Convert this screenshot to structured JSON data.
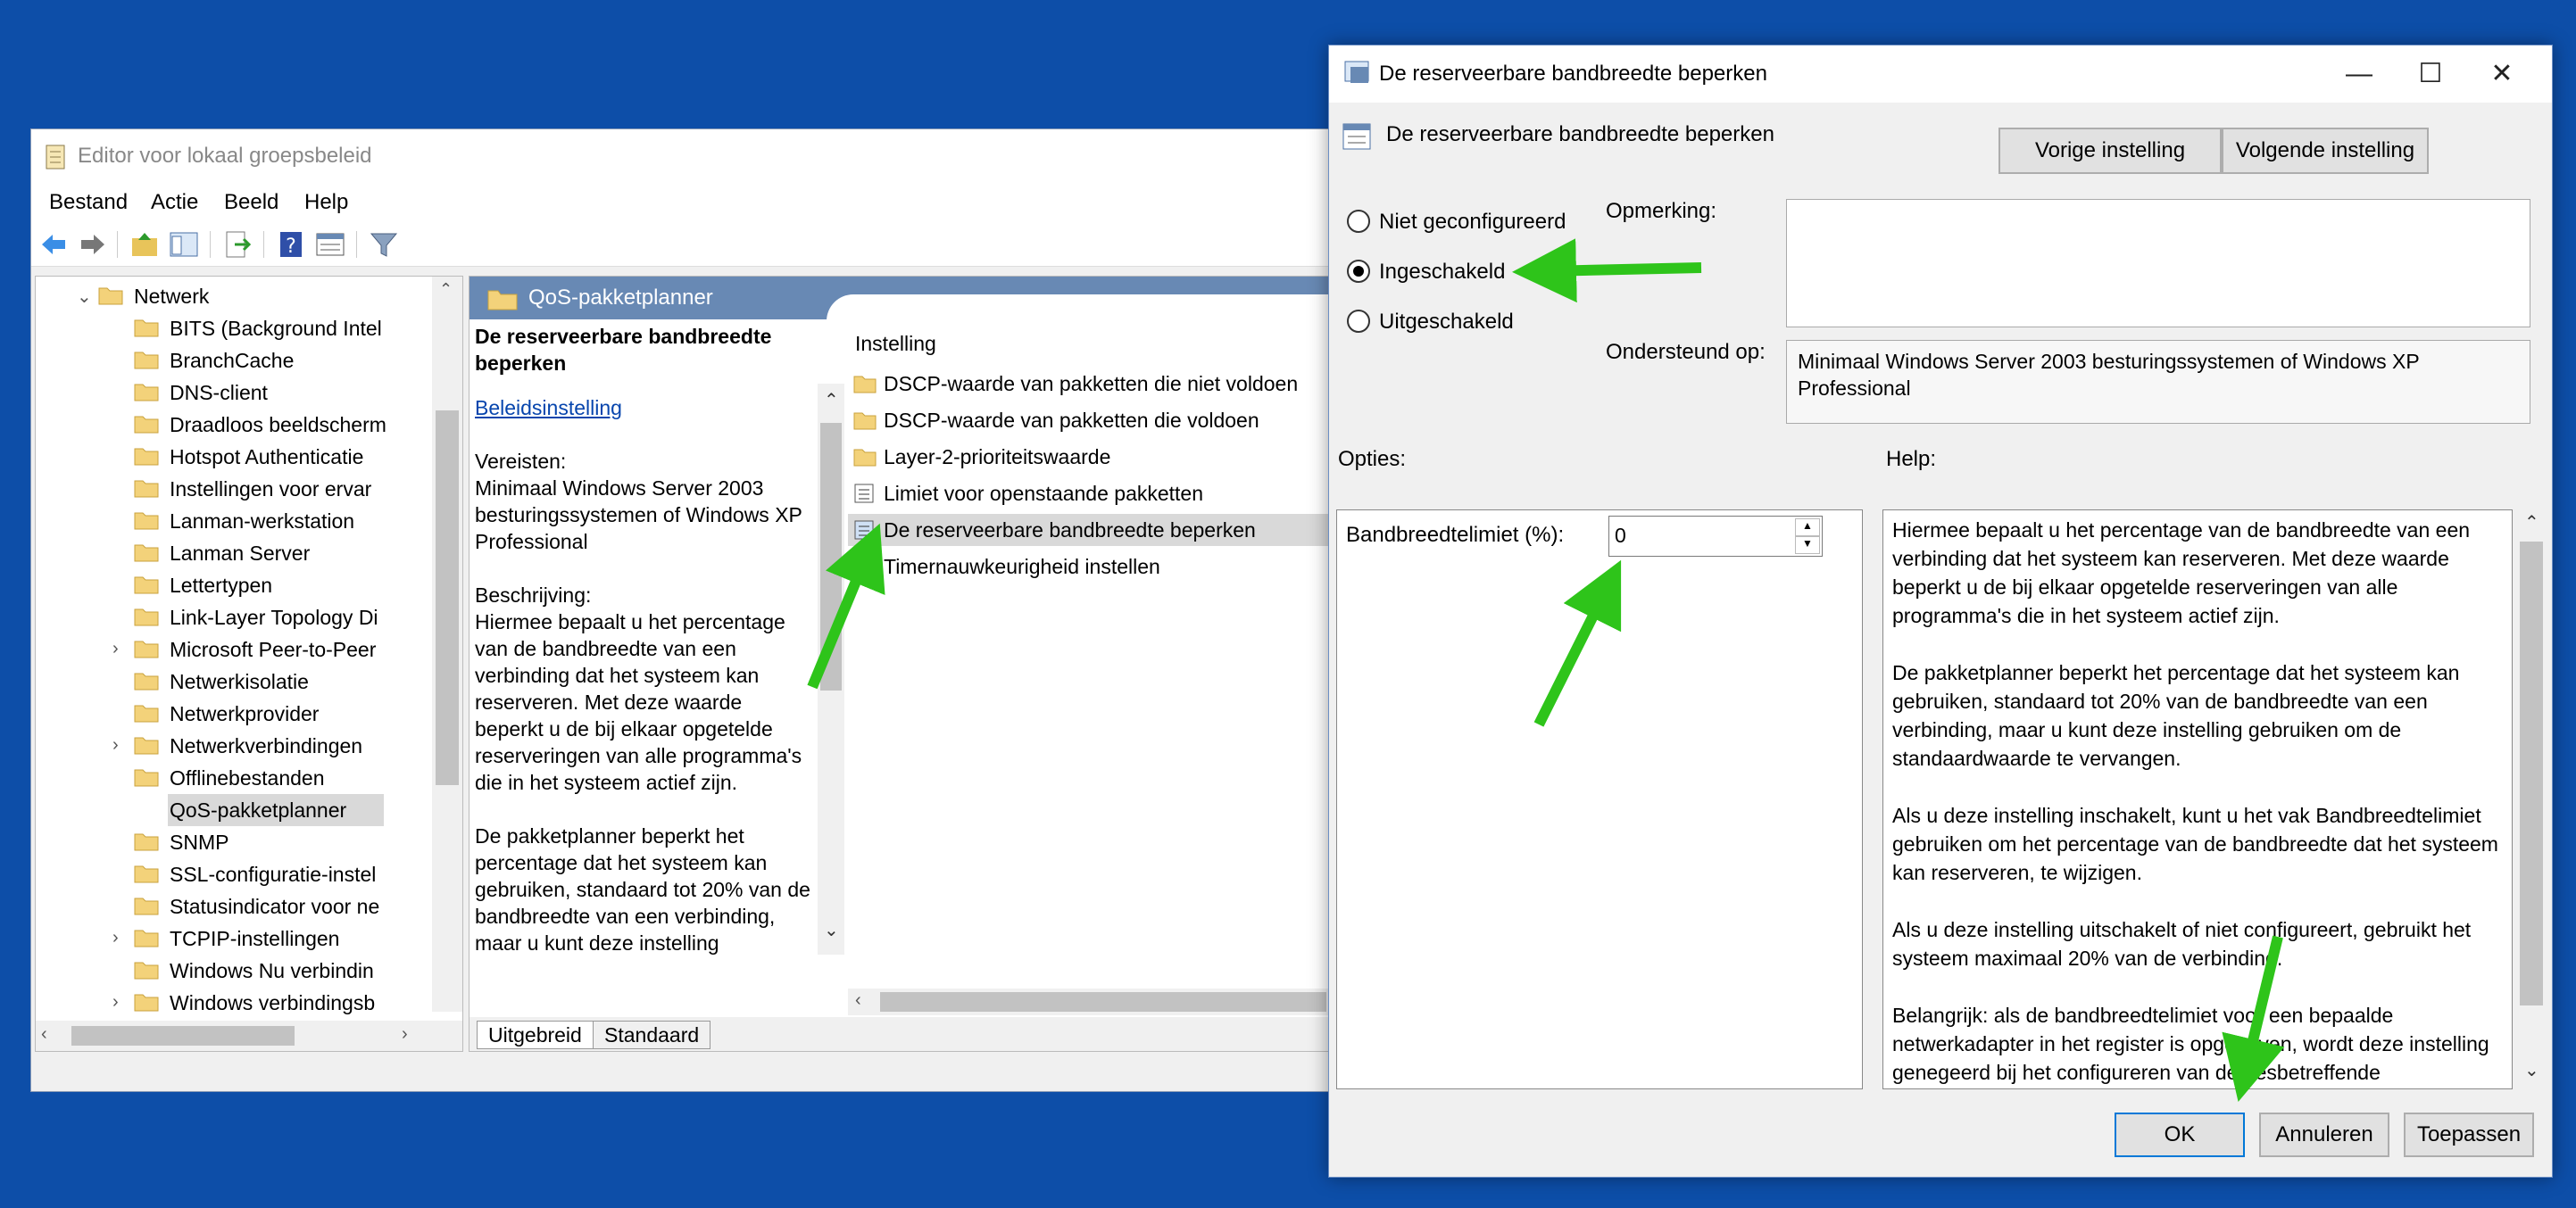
{
  "editor": {
    "title": "Editor voor lokaal groepsbeleid",
    "menu": [
      "Bestand",
      "Actie",
      "Beeld",
      "Help"
    ],
    "tree": [
      {
        "label": "Netwerk",
        "depth": 0,
        "expander": "v"
      },
      {
        "label": "BITS (Background Intel",
        "depth": 1,
        "expander": ""
      },
      {
        "label": "BranchCache",
        "depth": 1,
        "expander": ""
      },
      {
        "label": "DNS-client",
        "depth": 1,
        "expander": ""
      },
      {
        "label": "Draadloos beeldscherm",
        "depth": 1,
        "expander": ""
      },
      {
        "label": "Hotspot Authenticatie",
        "depth": 1,
        "expander": ""
      },
      {
        "label": "Instellingen voor ervar",
        "depth": 1,
        "expander": ""
      },
      {
        "label": "Lanman-werkstation",
        "depth": 1,
        "expander": ""
      },
      {
        "label": "Lanman Server",
        "depth": 1,
        "expander": ""
      },
      {
        "label": "Lettertypen",
        "depth": 1,
        "expander": ""
      },
      {
        "label": "Link-Layer Topology Di",
        "depth": 1,
        "expander": ""
      },
      {
        "label": "Microsoft Peer-to-Peer",
        "depth": 1,
        "expander": ">"
      },
      {
        "label": "Netwerkisolatie",
        "depth": 1,
        "expander": ""
      },
      {
        "label": "Netwerkprovider",
        "depth": 1,
        "expander": ""
      },
      {
        "label": "Netwerkverbindingen",
        "depth": 1,
        "expander": ">"
      },
      {
        "label": "Offlinebestanden",
        "depth": 1,
        "expander": ""
      },
      {
        "label": "QoS-pakketplanner",
        "depth": 1,
        "expander": ">",
        "selected": true
      },
      {
        "label": "SNMP",
        "depth": 1,
        "expander": ""
      },
      {
        "label": "SSL-configuratie-instel",
        "depth": 1,
        "expander": ""
      },
      {
        "label": "Statusindicator voor ne",
        "depth": 1,
        "expander": ""
      },
      {
        "label": "TCPIP-instellingen",
        "depth": 1,
        "expander": ">"
      },
      {
        "label": "Windows Nu verbindin",
        "depth": 1,
        "expander": ""
      },
      {
        "label": "Windows verbindingsb",
        "depth": 1,
        "expander": ">"
      }
    ],
    "pane_header": "QoS-pakketplanner",
    "desc": {
      "title": "De reserveerbare bandbreedte beperken",
      "link": "Beleidsinstelling",
      "requirements_label": "Vereisten:",
      "requirements": "Minimaal Windows Server 2003 besturingssystemen of Windows XP Professional",
      "description_label": "Beschrijving:",
      "description": "Hiermee bepaalt u het percentage van de bandbreedte van een verbinding dat het systeem kan reserveren. Met deze waarde beperkt u de bij elkaar opgetelde reserveringen van alle programma's die in het systeem actief zijn.",
      "description2": "De pakketplanner beperkt het percentage dat het systeem kan gebruiken, standaard tot 20% van de bandbreedte van een verbinding, maar u kunt deze instelling"
    },
    "list_header": "Instelling",
    "list": [
      {
        "label": "DSCP-waarde van pakketten die niet voldoen",
        "kind": "folder"
      },
      {
        "label": "DSCP-waarde van pakketten die voldoen",
        "kind": "folder"
      },
      {
        "label": "Layer-2-prioriteitswaarde",
        "kind": "folder"
      },
      {
        "label": "Limiet voor openstaande pakketten",
        "kind": "setting"
      },
      {
        "label": "De reserveerbare bandbreedte beperken",
        "kind": "setting",
        "selected": true
      },
      {
        "label": "Timernauwkeurigheid instellen",
        "kind": "setting"
      }
    ],
    "tabs": [
      "Uitgebreid",
      "Standaard"
    ]
  },
  "dialog": {
    "title": "De reserveerbare bandbreedte beperken",
    "header": "De reserveerbare bandbreedte beperken",
    "prev_btn": "Vorige instelling",
    "next_btn": "Volgende instelling",
    "radios": [
      {
        "label": "Niet geconfigureerd",
        "checked": false
      },
      {
        "label": "Ingeschakeld",
        "checked": true
      },
      {
        "label": "Uitgeschakeld",
        "checked": false
      }
    ],
    "comment_label": "Opmerking:",
    "comment_value": "",
    "supported_label": "Ondersteund op:",
    "supported_value": "Minimaal Windows Server 2003 besturingssystemen of Windows XP Professional",
    "options_label": "Opties:",
    "help_label": "Help:",
    "bandwidth_label": "Bandbreedtelimiet (%):",
    "bandwidth_value": "0",
    "help": [
      "Hiermee bepaalt u het percentage van de bandbreedte van een verbinding dat het systeem kan reserveren. Met deze waarde beperkt u de bij elkaar opgetelde reserveringen van alle programma's die in het systeem actief zijn.",
      "De pakketplanner beperkt het percentage dat het systeem kan gebruiken, standaard tot 20% van de bandbreedte van een verbinding, maar u kunt deze instelling gebruiken om de standaardwaarde te vervangen.",
      "Als u deze instelling inschakelt, kunt u het vak Bandbreedtelimiet gebruiken om het percentage van de bandbreedte dat het systeem kan reserveren, te wijzigen.",
      "Als u deze instelling uitschakelt of niet configureert, gebruikt het systeem maximaal 20% van de verbinding.",
      "Belangrijk: als de bandbreedtelimiet voor een bepaalde netwerkadapter in het register is opgegeven, wordt deze instelling genegeerd bij het configureren van de desbetreffende"
    ],
    "ok_btn": "OK",
    "cancel_btn": "Annuleren",
    "apply_btn": "Toepassen"
  },
  "colors": {
    "desktop": "#0d4ea8",
    "arrow": "#2ec41a",
    "header": "#6889b4",
    "accent": "#0078d7"
  }
}
